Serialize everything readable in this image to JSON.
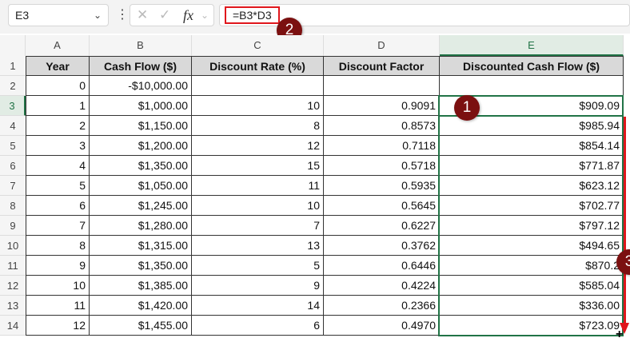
{
  "name_box": "E3",
  "formula_bar": {
    "cancel_icon": "x-icon",
    "enter_icon": "check-icon",
    "fx_label": "fx",
    "formula": "=B3*D3"
  },
  "columns": [
    "A",
    "B",
    "C",
    "D",
    "E"
  ],
  "rows": [
    "1",
    "2",
    "3",
    "4",
    "5",
    "6",
    "7",
    "8",
    "9",
    "10",
    "11",
    "12",
    "13",
    "14"
  ],
  "headers": [
    "Year",
    "Cash Flow ($)",
    "Discount Rate (%)",
    "Discount Factor",
    "Discounted Cash Flow ($)"
  ],
  "data": [
    [
      "0",
      "-$10,000.00",
      "",
      "",
      ""
    ],
    [
      "1",
      "$1,000.00",
      "10",
      "0.9091",
      "$909.09"
    ],
    [
      "2",
      "$1,150.00",
      "8",
      "0.8573",
      "$985.94"
    ],
    [
      "3",
      "$1,200.00",
      "12",
      "0.7118",
      "$854.14"
    ],
    [
      "4",
      "$1,350.00",
      "15",
      "0.5718",
      "$771.87"
    ],
    [
      "5",
      "$1,050.00",
      "11",
      "0.5935",
      "$623.12"
    ],
    [
      "6",
      "$1,245.00",
      "10",
      "0.5645",
      "$702.77"
    ],
    [
      "7",
      "$1,280.00",
      "7",
      "0.6227",
      "$797.12"
    ],
    [
      "8",
      "$1,315.00",
      "13",
      "0.3762",
      "$494.65"
    ],
    [
      "9",
      "$1,350.00",
      "5",
      "0.6446",
      "$870.2"
    ],
    [
      "10",
      "$1,385.00",
      "9",
      "0.4224",
      "$585.04"
    ],
    [
      "11",
      "$1,420.00",
      "14",
      "0.2366",
      "$336.00"
    ],
    [
      "12",
      "$1,455.00",
      "6",
      "0.4970",
      "$723.09"
    ]
  ],
  "badges": [
    "1",
    "2",
    "3"
  ],
  "colors": {
    "accent": "#217346",
    "highlight": "#e0161c",
    "badge": "#7b1010"
  }
}
